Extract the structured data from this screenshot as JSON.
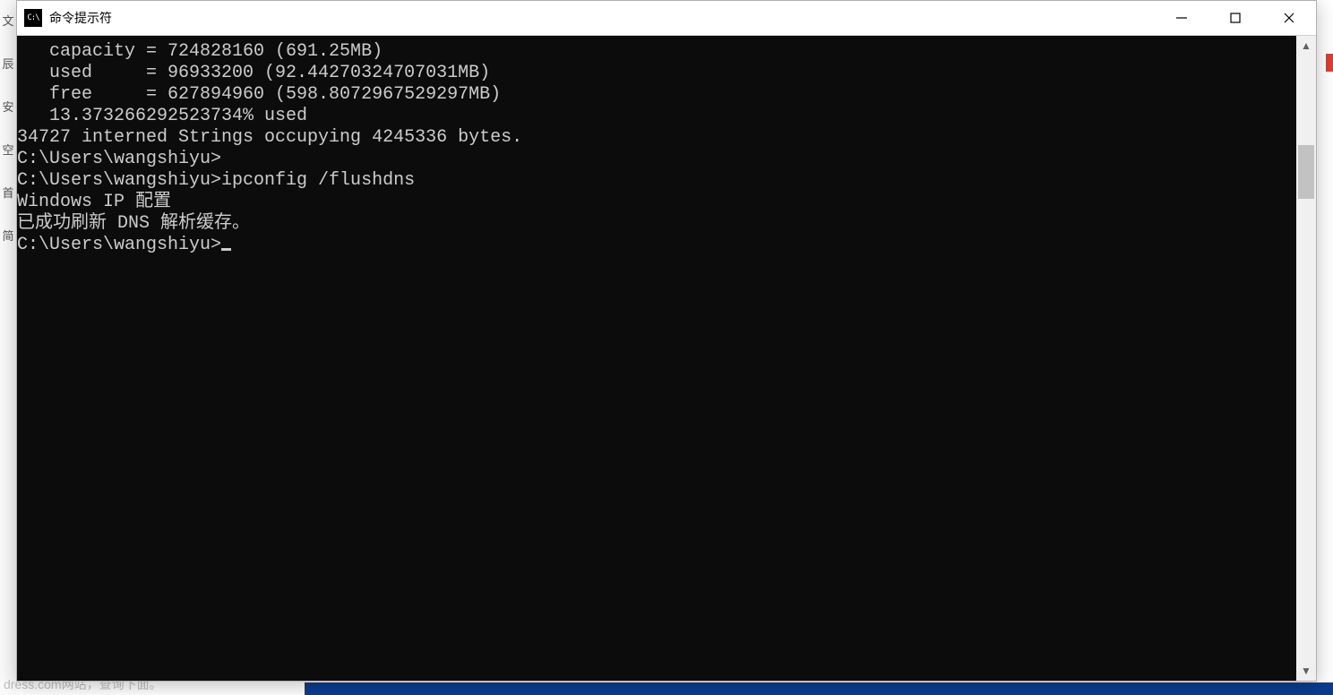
{
  "window": {
    "title": "命令提示符",
    "icon_label": "C:\\"
  },
  "background": {
    "left_chars": "文\n\n辰\n\n安\n\n空\n\n首\n\n简",
    "bottom_text": "dress.com网站，查询下面。"
  },
  "console": {
    "lines": [
      "   capacity = 724828160 (691.25MB)",
      "   used     = 96933200 (92.44270324707031MB)",
      "   free     = 627894960 (598.8072967529297MB)",
      "   13.373266292523734% used",
      "",
      "34727 interned Strings occupying 4245336 bytes.",
      "",
      "C:\\Users\\wangshiyu>",
      "C:\\Users\\wangshiyu>ipconfig /flushdns",
      "",
      "Windows IP 配置",
      "",
      "已成功刷新 DNS 解析缓存。",
      ""
    ],
    "prompt": "C:\\Users\\wangshiyu>"
  }
}
